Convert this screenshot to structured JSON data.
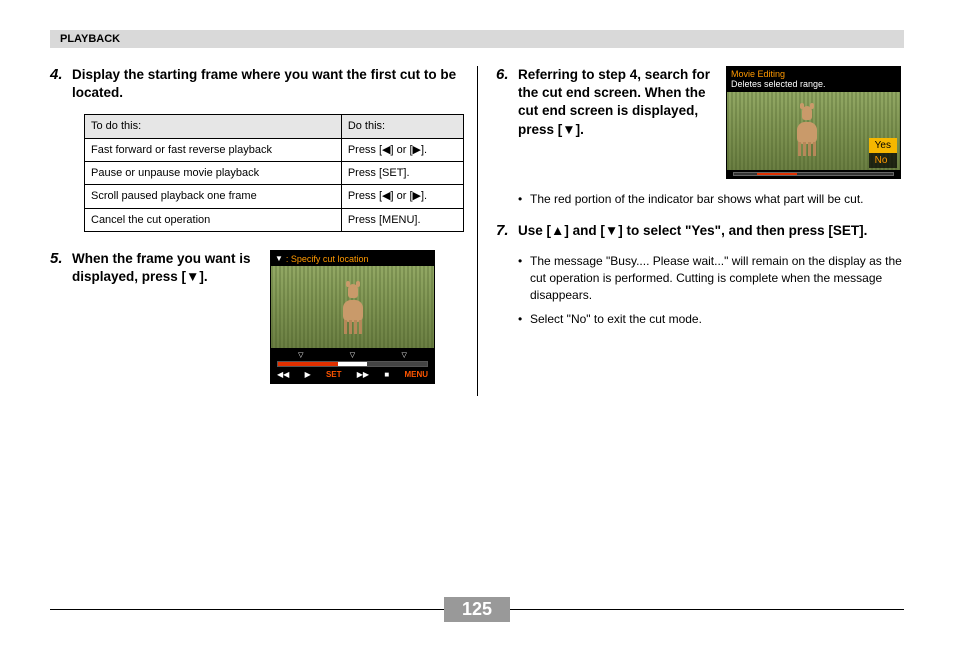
{
  "header": "PLAYBACK",
  "page_number": "125",
  "left": {
    "step4": {
      "num": "4.",
      "title": "Display the starting frame where you want the first cut to be located."
    },
    "table": {
      "col1_header": "To do this:",
      "col2_header": "Do this:",
      "rows": [
        {
          "a": "Fast forward or fast reverse playback",
          "b": "Press [◀] or [▶]."
        },
        {
          "a": "Pause or unpause movie playback",
          "b": "Press [SET]."
        },
        {
          "a": "Scroll paused playback one frame",
          "b": "Press [◀] or [▶]."
        },
        {
          "a": "Cancel the cut operation",
          "b": "Press [MENU]."
        }
      ]
    },
    "step5": {
      "num": "5.",
      "title": "When the frame you want is displayed, press [▼].",
      "screen": {
        "top_label": ": Specify cut location",
        "btn_set": "SET",
        "btn_menu": "MENU"
      }
    }
  },
  "right": {
    "step6": {
      "num": "6.",
      "title": "Referring to step 4, search for the cut end screen. When the cut end screen is displayed, press [▼].",
      "bullet1": "The red portion of the indicator bar shows what part will be cut.",
      "screen": {
        "title1": "Movie Editing",
        "title2": "Deletes selected range.",
        "opt_yes": "Yes",
        "opt_no": "No"
      }
    },
    "step7": {
      "num": "7.",
      "title": "Use [▲] and [▼] to select \"Yes\", and then press [SET].",
      "bullet1": "The message \"Busy.... Please wait...\" will remain on the display as the cut operation is performed. Cutting is complete when the message disappears.",
      "bullet2": "Select \"No\" to exit the cut mode."
    }
  }
}
